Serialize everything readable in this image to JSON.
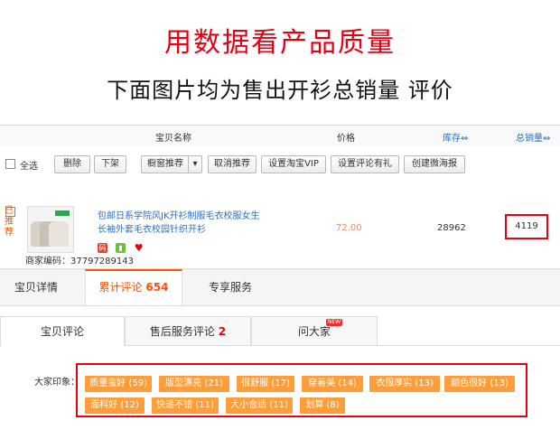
{
  "headline": "用数据看产品质量",
  "subheadline": "下面图片均为售出开衫总销量 评价",
  "table_header": {
    "name": "宝贝名称",
    "price": "价格",
    "stock": "库存⇔",
    "sales": "总销量⇔"
  },
  "toolbar": {
    "select_all": "全选",
    "delete": "删除",
    "off_shelf": "下架",
    "window_recommend": "橱窗推荐",
    "cancel_recommend": "取消推荐",
    "set_vip": "设置淘宝VIP",
    "set_review_gift": "设置评论有礼",
    "create_poster": "创建微海报"
  },
  "product": {
    "recommended_tag": "已推荐",
    "title_line1": "包邮日系学院风JK开衫制服毛衣校服女生",
    "title_line2": "长袖外套毛衣校园针织开衫",
    "merchant_code": "商家编码：37797289143",
    "price": "72.00",
    "stock": "28962",
    "total_sales": "4119",
    "icons": [
      "code-icon",
      "mobile-icon",
      "heart-icon"
    ],
    "code_icon_char": "码"
  },
  "main_tabs": [
    {
      "label": "宝贝详情",
      "count": ""
    },
    {
      "label": "累计评论",
      "count": "654"
    },
    {
      "label": "专享服务",
      "count": ""
    }
  ],
  "sub_tabs": [
    {
      "label": "宝贝评论",
      "count": ""
    },
    {
      "label": "售后服务评论",
      "count": "2"
    },
    {
      "label": "问大家",
      "count": "",
      "badge": "NEW"
    }
  ],
  "impressions": {
    "label": "大家印象：",
    "tags": [
      "质量蛮好 (59)",
      "版型漂亮 (21)",
      "很舒服 (17)",
      "穿着美 (14)",
      "衣服厚实 (13)",
      "颜色很好 (13)",
      "面料好 (12)",
      "快递不错 (11)",
      "大小合适 (11)",
      "划算 (8)"
    ]
  },
  "colors": {
    "headline": "#e60012",
    "highlight_border": "#e60012",
    "tag_bg": "#ff9e39",
    "tab_accent": "#ff5000",
    "link": "#2f6fb8"
  }
}
